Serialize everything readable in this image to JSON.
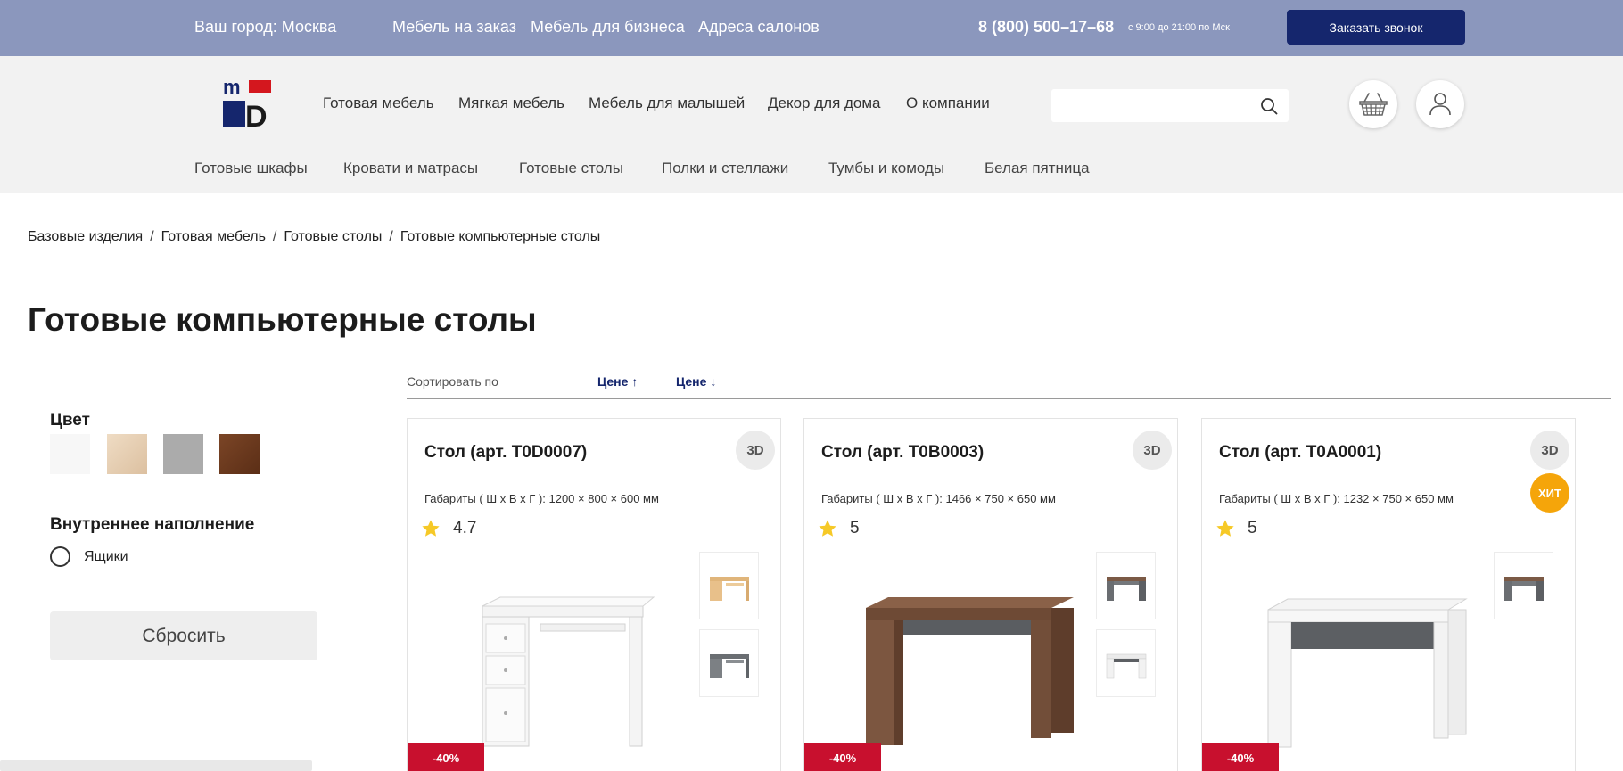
{
  "topbar": {
    "city": "Ваш город: Москва",
    "links": [
      "Мебель на заказ",
      "Мебель для бизнеса",
      "Адреса салонов"
    ],
    "phone": "8 (800) 500–17–68",
    "hours": "с 9:00 до 21:00 по Мск",
    "call_button": "Заказать звонок"
  },
  "header": {
    "logo_icon": "md-logo",
    "main_nav": [
      "Готовая мебель",
      "Мягкая мебель",
      "Мебель для малышей",
      "Декор для дома",
      "О компании"
    ],
    "search_placeholder": "",
    "cart_icon": "basket-icon",
    "user_icon": "user-icon",
    "sub_nav": [
      "Готовые шкафы",
      "Кровати и матрасы",
      "Готовые столы",
      "Полки и стеллажи",
      "Тумбы и комоды",
      "Белая пятница"
    ]
  },
  "breadcrumb": [
    "Базовые изделия",
    "Готовая мебель",
    "Готовые столы",
    "Готовые компьютерные столы"
  ],
  "breadcrumb_sep": "/",
  "page_title": "Готовые компьютерные столы",
  "filters": {
    "color_title": "Цвет",
    "colors": [
      "#f7f7f7",
      "#e9d3bb",
      "#ababab",
      "#6b3a1f"
    ],
    "fill_title": "Внутреннее наполнение",
    "fill_option": "Ящики",
    "reset_button": "Сбросить"
  },
  "sort": {
    "label": "Сортировать по",
    "options": [
      "Цене ↑",
      "Цене ↓"
    ]
  },
  "products": [
    {
      "title": "Стол (арт. T0D0007)",
      "badge_3d": "3D",
      "dims": "Габариты ( Ш х В х Г ): 1200 × 800 × 600 мм",
      "rating": "4.7",
      "discount": "-40%",
      "hit": ""
    },
    {
      "title": "Стол (арт. T0B0003)",
      "badge_3d": "3D",
      "dims": "Габариты ( Ш х В х Г ): 1466 × 750 × 650 мм",
      "rating": "5",
      "discount": "-40%",
      "hit": ""
    },
    {
      "title": "Стол (арт. T0A0001)",
      "badge_3d": "3D",
      "dims": "Габариты ( Ш х В х Г ): 1232 × 750 × 650 мм",
      "rating": "5",
      "discount": "-40%",
      "hit": "ХИТ"
    }
  ],
  "colors": {
    "topbar": "#8b97bd",
    "accent_navy": "#15266d",
    "logo_red": "#d4171e",
    "discount_red": "#c8102e",
    "hit_orange": "#f5a50a",
    "star_yellow": "#f6c927"
  }
}
